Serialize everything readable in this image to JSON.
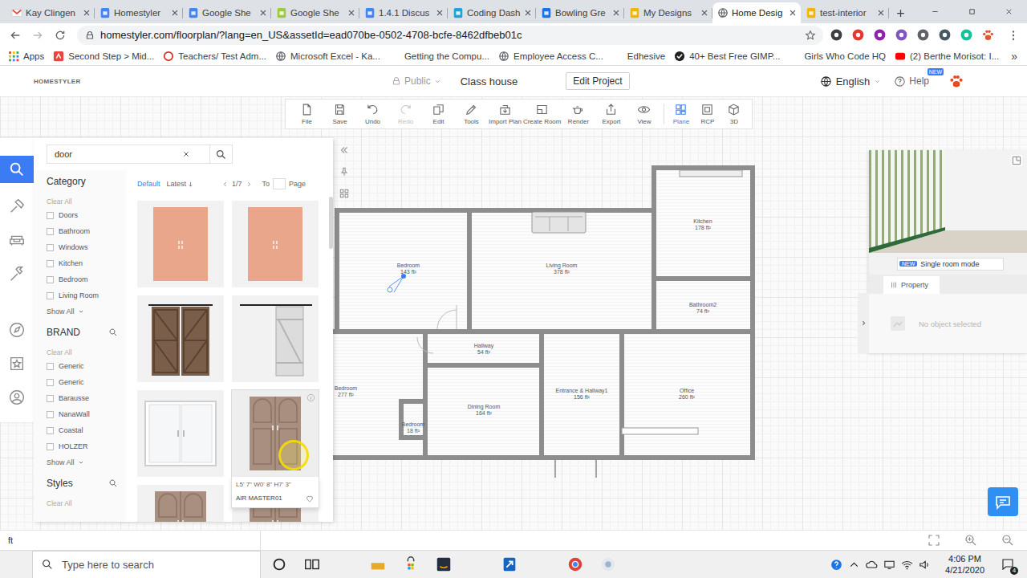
{
  "browser": {
    "tabs": [
      {
        "title": "Kay Clingen",
        "kind": "gmail",
        "selected": false
      },
      {
        "title": "Homestyler",
        "kind": "classroom",
        "selected": false
      },
      {
        "title": "Google She",
        "kind": "classroom",
        "selected": false
      },
      {
        "title": "Google She",
        "kind": "sheets",
        "selected": false
      },
      {
        "title": "1.4.1 Discus",
        "kind": "classroom",
        "selected": false
      },
      {
        "title": "Coding Dash",
        "kind": "edhesive",
        "selected": false
      },
      {
        "title": "Bowling Gre",
        "kind": "calendar",
        "selected": false
      },
      {
        "title": "My Designs",
        "kind": "slides",
        "selected": false
      },
      {
        "title": "Home Desig",
        "kind": "globe",
        "selected": true
      },
      {
        "title": "test-interior",
        "kind": "slides",
        "selected": false
      }
    ],
    "url": "homestyler.com/floorplan/?lang=en_US&assetId=ead070be-0502-4708-bcfe-8462dfbeb01c",
    "bookmarks": [
      {
        "label": "Apps",
        "kind": "apps"
      },
      {
        "label": "Second Step > Mid...",
        "kind": "secondstep"
      },
      {
        "label": "Teachers/ Test Adm...",
        "kind": "ring"
      },
      {
        "label": "Microsoft Excel - Ka...",
        "kind": "globe"
      },
      {
        "label": "Getting the Compu...",
        "kind": "pin"
      },
      {
        "label": "Employee Access C...",
        "kind": "globe"
      },
      {
        "label": "Edhesive",
        "kind": "folder"
      },
      {
        "label": "40+ Best Free GIMP...",
        "kind": "check"
      },
      {
        "label": "Girls Who Code HQ",
        "kind": "folder"
      },
      {
        "label": "(2) Berthe Morisot: I...",
        "kind": "youtube"
      }
    ],
    "bookmarks_more": "»"
  },
  "app": {
    "logo": "HOMESTYLER",
    "visibility": "Public",
    "project": "Class house",
    "edit_button": "Edit Project",
    "language": "English",
    "help": "Help",
    "help_badge": "NEW",
    "toolbar": [
      {
        "label": "File",
        "kind": "file",
        "disabled": false
      },
      {
        "label": "Save",
        "kind": "save",
        "disabled": false
      },
      {
        "label": "Undo",
        "kind": "undo",
        "disabled": false
      },
      {
        "label": "Redo",
        "kind": "redo",
        "disabled": true
      },
      {
        "label": "Edit",
        "kind": "edit",
        "disabled": false
      },
      {
        "label": "Tools",
        "kind": "tools",
        "disabled": false
      },
      {
        "label": "Import Plan",
        "kind": "import",
        "disabled": false
      },
      {
        "label": "Create Room",
        "kind": "room",
        "disabled": false
      },
      {
        "label": "Render",
        "kind": "render",
        "disabled": false
      },
      {
        "label": "Export",
        "kind": "export",
        "disabled": false
      },
      {
        "label": "View",
        "kind": "view",
        "disabled": false
      }
    ],
    "view_modes": [
      {
        "label": "Plane",
        "kind": "plane",
        "selected": true
      },
      {
        "label": "RCP",
        "kind": "rcp",
        "selected": false
      },
      {
        "label": "3D",
        "kind": "cube",
        "selected": false
      }
    ],
    "rail": [
      {
        "kind": "search",
        "selected": true
      },
      {
        "kind": "build",
        "selected": false
      },
      {
        "kind": "sofa",
        "selected": false
      },
      {
        "kind": "hammer",
        "selected": false
      },
      {
        "kind": "compass",
        "selected": false
      },
      {
        "kind": "star",
        "selected": false
      },
      {
        "kind": "person",
        "selected": false
      }
    ],
    "search": {
      "query": "door"
    },
    "filters": [
      {
        "title": "Category",
        "clear": "Clear All",
        "searchable": false,
        "show_all": "Show All",
        "options": [
          {
            "label": "Doors",
            "checked": false
          },
          {
            "label": "Bathroom",
            "checked": false
          },
          {
            "label": "Windows",
            "checked": false
          },
          {
            "label": "Kitchen",
            "checked": false
          },
          {
            "label": "Bedroom",
            "checked": false
          },
          {
            "label": "Living Room",
            "checked": false
          }
        ]
      },
      {
        "title": "BRAND",
        "clear": "Clear All",
        "searchable": true,
        "show_all": "Show All",
        "options": [
          {
            "label": "Generic",
            "checked": false
          },
          {
            "label": "Generic",
            "checked": false
          },
          {
            "label": "Barausse",
            "checked": false
          },
          {
            "label": "NanaWall",
            "checked": false
          },
          {
            "label": "Coastal",
            "checked": false
          },
          {
            "label": "HOLZER",
            "checked": false
          }
        ]
      },
      {
        "title": "Styles",
        "clear": "Clear All",
        "searchable": true,
        "options": []
      }
    ],
    "sort": [
      {
        "label": "Default",
        "selected": true
      },
      {
        "label": "Latest",
        "selected": false
      }
    ],
    "pagination": {
      "page": "1/7",
      "to": "To",
      "unit": "Page"
    },
    "products": [
      {
        "kind": "panel-door",
        "hovered": false
      },
      {
        "kind": "panel-door",
        "hovered": false
      },
      {
        "kind": "barn-door",
        "hovered": false
      },
      {
        "kind": "sliding-barn",
        "hovered": false
      },
      {
        "kind": "sliding-glass",
        "hovered": false
      },
      {
        "kind": "double-door",
        "hovered": true,
        "size": "L5' 7\" W0' 8\" H7' 3\"",
        "name": "AIR MASTER01"
      },
      {
        "kind": "double-door",
        "hovered": false
      },
      {
        "kind": "double-door",
        "hovered": false
      }
    ],
    "rooms": [
      {
        "name": "Bedroom",
        "area": "143 ft²"
      },
      {
        "name": "Living Room",
        "area": "378 ft²"
      },
      {
        "name": "Kitchen",
        "area": "178 ft²"
      },
      {
        "name": "Bathroom2",
        "area": "74 ft²"
      },
      {
        "name": "Hallway",
        "area": "54 ft²"
      },
      {
        "name": "Dining Room",
        "area": "164 ft²"
      },
      {
        "name": "Entrance & Hallway1",
        "area": "156 ft²"
      },
      {
        "name": "Office",
        "area": "260 ft²"
      },
      {
        "name": "Bedroom",
        "area": "277 ft²"
      },
      {
        "name": "Bedroom",
        "area": "18 ft²"
      }
    ],
    "preview": {
      "badge": "NEW",
      "label": "Single room mode"
    },
    "property": {
      "tab": "Property",
      "empty": "No object selected"
    },
    "unit": "ft"
  },
  "taskbar": {
    "search_placeholder": "Type here to search",
    "apps": [
      {
        "kind": "cortana"
      },
      {
        "kind": "taskview"
      },
      {
        "kind": "edge"
      },
      {
        "kind": "explorer"
      },
      {
        "kind": "store"
      },
      {
        "kind": "amazon"
      },
      {
        "kind": "dropbox"
      },
      {
        "kind": "bluebird"
      },
      {
        "kind": "office"
      },
      {
        "kind": "chrome"
      },
      {
        "kind": "recorder"
      }
    ],
    "time": "4:06 PM",
    "date": "4/21/2020",
    "notifications": "4"
  }
}
